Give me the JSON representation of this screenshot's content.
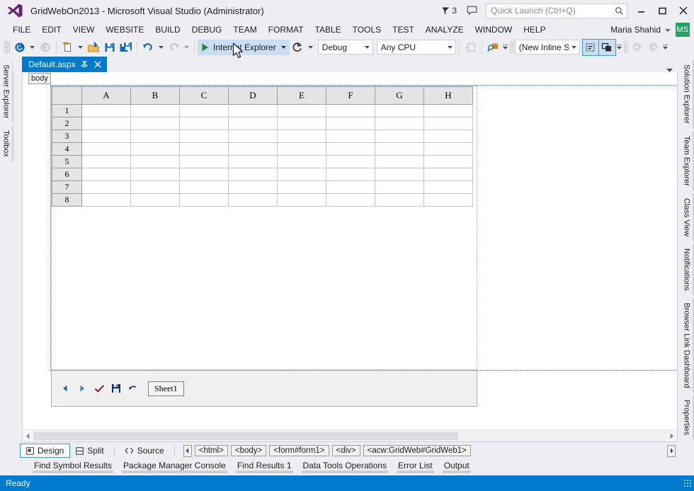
{
  "window": {
    "title": "GridWebOn2013 - Microsoft Visual Studio (Administrator)",
    "notification_count": "3",
    "minimize_label": "Minimize",
    "maximize_label": "Maximize",
    "close_label": "Close",
    "accent_color": "#68217a",
    "status_bar_color": "#007acc"
  },
  "quick_launch": {
    "placeholder": "Quick Launch (Ctrl+Q)",
    "value": ""
  },
  "user": {
    "name": "Maria Shahid",
    "initials": "MS",
    "avatar_color": "#25a162"
  },
  "menubar": {
    "items": [
      {
        "label": "FILE"
      },
      {
        "label": "EDIT"
      },
      {
        "label": "VIEW"
      },
      {
        "label": "WEBSITE"
      },
      {
        "label": "BUILD"
      },
      {
        "label": "DEBUG"
      },
      {
        "label": "TEAM"
      },
      {
        "label": "FORMAT"
      },
      {
        "label": "TABLE"
      },
      {
        "label": "TOOLS"
      },
      {
        "label": "TEST"
      },
      {
        "label": "ANALYZE"
      },
      {
        "label": "WINDOW"
      },
      {
        "label": "HELP"
      }
    ]
  },
  "toolbar": {
    "navigate_backward": "Navigate Backward",
    "navigate_forward": "Navigate Forward",
    "new_item": "New Item",
    "open_file": "Open File",
    "save": "Save",
    "save_all": "Save All",
    "undo": "Undo",
    "redo": "Redo",
    "run_label": "Internet Explorer",
    "refresh": "Refresh",
    "config_value": "Debug",
    "platform_value": "Any CPU",
    "style_value": "(New Inline Style",
    "style_full": "(New Inline Style)"
  },
  "left_rail": {
    "items": [
      {
        "label": "Server Explorer"
      },
      {
        "label": "Toolbox"
      }
    ]
  },
  "right_rail": {
    "items": [
      {
        "label": "Solution Explorer"
      },
      {
        "label": "Team Explorer"
      },
      {
        "label": "Class View"
      },
      {
        "label": "Notifications"
      },
      {
        "label": "Browser Link Dashboard"
      },
      {
        "label": "Properties"
      }
    ]
  },
  "document": {
    "tab_label": "Default.aspx",
    "pin_label": "Pin Tab",
    "close_label": "Close Tab",
    "tag_chip": "body"
  },
  "grid": {
    "columns": [
      "A",
      "B",
      "C",
      "D",
      "E",
      "F",
      "G",
      "H"
    ],
    "rows": [
      "1",
      "2",
      "3",
      "4",
      "5",
      "6",
      "7",
      "8"
    ],
    "cells": [
      [
        "",
        "",
        "",
        "",
        "",
        "",
        "",
        ""
      ],
      [
        "",
        "",
        "",
        "",
        "",
        "",
        "",
        ""
      ],
      [
        "",
        "",
        "",
        "",
        "",
        "",
        "",
        ""
      ],
      [
        "",
        "",
        "",
        "",
        "",
        "",
        "",
        ""
      ],
      [
        "",
        "",
        "",
        "",
        "",
        "",
        "",
        ""
      ],
      [
        "",
        "",
        "",
        "",
        "",
        "",
        "",
        ""
      ],
      [
        "",
        "",
        "",
        "",
        "",
        "",
        "",
        ""
      ],
      [
        "",
        "",
        "",
        "",
        "",
        "",
        "",
        ""
      ]
    ],
    "sheet_tab": "Sheet1",
    "nav_prev": "Previous Sheet",
    "nav_next": "Next Sheet",
    "submit": "Submit",
    "save": "Save",
    "undo": "Undo"
  },
  "view_bar": {
    "design": "Design",
    "split": "Split",
    "source": "Source",
    "breadcrumbs": [
      {
        "label": "<html>"
      },
      {
        "label": "<body>"
      },
      {
        "label": "<form#form1>"
      },
      {
        "label": "<div>"
      },
      {
        "label": "<acw:GridWeb#GridWeb1>"
      }
    ]
  },
  "bottom_tabs": {
    "items": [
      {
        "label": "Find Symbol Results"
      },
      {
        "label": "Package Manager Console"
      },
      {
        "label": "Find Results 1"
      },
      {
        "label": "Data Tools Operations"
      },
      {
        "label": "Error List"
      },
      {
        "label": "Output"
      }
    ]
  },
  "status": {
    "text": "Ready"
  }
}
